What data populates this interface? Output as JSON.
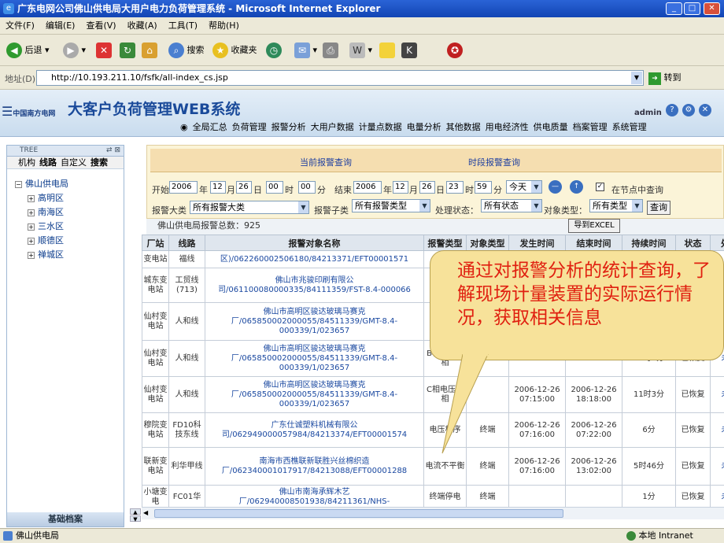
{
  "window": {
    "title": "广东电网公司佛山供电局大用户电力负荷管理系统 - Microsoft Internet Explorer"
  },
  "menu": [
    "文件(F)",
    "编辑(E)",
    "查看(V)",
    "收藏(A)",
    "工具(T)",
    "帮助(H)"
  ],
  "toolbar": {
    "back": "后退",
    "search": "搜索",
    "favorites": "收藏夹"
  },
  "address": {
    "label": "地址(D)",
    "url": "http://10.193.211.10/fsfk/all-index_cs.jsp",
    "go": "转到"
  },
  "app": {
    "logo_text": "中国南方电网",
    "title": "大客户负荷管理WEB系统",
    "user": "admin",
    "nav": [
      "全局汇总",
      "负荷管理",
      "报警分析",
      "大用户数据",
      "计量点数据",
      "电量分析",
      "其他数据",
      "用电经济性",
      "供电质量",
      "档案管理",
      "系统管理"
    ]
  },
  "tree": {
    "header": "TREE",
    "tabs": [
      "机构",
      "线路",
      "自定义",
      "搜索"
    ],
    "root": "佛山供电局",
    "children": [
      "高明区",
      "南海区",
      "三水区",
      "顺德区",
      "禅城区"
    ],
    "footer": "基础档案"
  },
  "query": {
    "tab_current": "当前报警查询",
    "tab_period": "时段报警查询",
    "start_label": "开始",
    "end_label": "结束",
    "year": "年",
    "month": "月",
    "day": "日",
    "hour": "时",
    "minute": "分",
    "start": {
      "year": "2006",
      "month": "12",
      "day": "26",
      "hour": "00",
      "minute": "00"
    },
    "end": {
      "year": "2006",
      "month": "12",
      "day": "26",
      "hour": "23",
      "minute": "59"
    },
    "period": "今天",
    "node_query": "在节点中查询",
    "alarm_major_label": "报警大类",
    "alarm_major": "所有报警大类",
    "alarm_minor_label": "报警子类",
    "alarm_minor": "所有报警类型",
    "status_label": "处理状态：",
    "status": "所有状态",
    "object_label": "对象类型：",
    "object": "所有类型",
    "search_btn": "查询"
  },
  "summary": "佛山供电局报警总数：925",
  "export": "导到EXCEL",
  "grid": {
    "headers": [
      "厂站",
      "线路",
      "报警对象名称",
      "报警类型",
      "对象类型",
      "发生时间",
      "结束时间",
      "持续时间",
      "状态",
      "处"
    ],
    "rows": [
      {
        "station": "变电站",
        "line": "福线",
        "name": "区)/062260002506180/84213371/EFT00001571",
        "type": "",
        "obj": "",
        "start": "",
        "end": "",
        "dur": "",
        "status": "",
        "act": ""
      },
      {
        "station": "城东变电站",
        "line": "工贸线(713)",
        "name": "佛山市兆骏印刷有限公司/061100080000335/84111359/FST-8.4-000066",
        "type": "",
        "obj": "",
        "start": "",
        "end": "",
        "dur": "",
        "status": "",
        "act": ""
      },
      {
        "station": "仙村变电站",
        "line": "人和线",
        "name": "佛山市高明区骏达玻璃马赛克厂/065850002000055/84511339/GMT-8.4-000339/1/023657",
        "type": "",
        "obj": "",
        "start": "",
        "end": "",
        "dur": "",
        "status": "",
        "act": ""
      },
      {
        "station": "仙村变电站",
        "line": "人和线",
        "name": "佛山市高明区骏达玻璃马赛克厂/065850002000055/84511339/GMT-8.4-000339/1/023657",
        "type": "B相电压断相",
        "obj": "",
        "start": "",
        "end": "18:18:00",
        "dur": "11时3分",
        "status": "已恢复",
        "act": "未"
      },
      {
        "station": "仙村变电站",
        "line": "人和线",
        "name": "佛山市高明区骏达玻璃马赛克厂/065850002000055/84511339/GMT-8.4-000339/1/023657",
        "type": "C相电压断相",
        "obj": "",
        "start": "2006-12-26 07:15:00",
        "end": "2006-12-26 18:18:00",
        "dur": "11时3分",
        "status": "已恢复",
        "act": "未"
      },
      {
        "station": "穆院变电站",
        "line": "FD10科技东线",
        "name": "广东仕诚塑料机械有限公司/062949000057984/84213374/EFT00001574",
        "type": "电压相序",
        "obj": "终端",
        "start": "2006-12-26 07:16:00",
        "end": "2006-12-26 07:22:00",
        "dur": "6分",
        "status": "已恢复",
        "act": "未"
      },
      {
        "station": "联新变电站",
        "line": "利华甲线",
        "name": "南海市西樵联新联胜兴丝棉织造厂/062340001017917/84213088/EFT00001288",
        "type": "电流不平衡",
        "obj": "终端",
        "start": "2006-12-26 07:16:00",
        "end": "2006-12-26 13:02:00",
        "dur": "5时46分",
        "status": "已恢复",
        "act": "未"
      },
      {
        "station": "小塘变电",
        "line": "FC01华",
        "name": "佛山市南海承辉木艺厂/062940008501938/84211361/NHS-",
        "type": "终端停电",
        "obj": "终端",
        "start": "",
        "end": "",
        "dur": "1分",
        "status": "已恢复",
        "act": "未"
      }
    ]
  },
  "callout": "通过对报警分析的统计查询，了解现场计量装置的实际运行情况，获取相关信息",
  "status": {
    "left": "佛山供电局",
    "zone": "本地 Intranet"
  },
  "colors": {
    "title_bar": "#1245b4",
    "callout_bg": "#f7e29a",
    "callout_text": "#e02010"
  }
}
